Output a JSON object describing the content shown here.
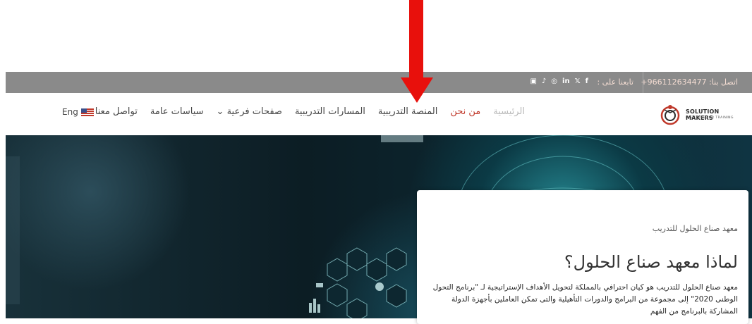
{
  "topbar": {
    "phone": "اتصل بنا: 966112634477+",
    "follow_label": "تابعنا على :",
    "social_icons": [
      "facebook-icon",
      "twitter-icon",
      "linkedin-icon",
      "instagram-icon",
      "bell-icon",
      "youtube-icon"
    ]
  },
  "logo": {
    "name": "SOLUTION MAKERS",
    "subtitle": "INSTITUTE FOR TRAINING"
  },
  "nav": {
    "items": [
      "الرئيسية",
      "من نحن",
      "المنصة التدريبية",
      "المسارات التدريبية",
      "صفحات فرعية ⌄",
      "سياسات عامة",
      "تواصل معنا"
    ],
    "lang": "Eng"
  },
  "card": {
    "label": "معهد صناع الحلول للتدريب",
    "title": "لماذا معهد صناع الحلول؟",
    "body": "معهد صناع الحلول للتدريب هو كيان احترافي بالمملكة لتحويل الأهداف الإستراتيجية لـ \"برنامج التحول الوطنى 2020\" إلى مجموعة من البرامج والدورات التأهيلية والتى تمكن العاملين بأجهزة الدولة المشاركة بالبرنامج من الفهم"
  },
  "colors": {
    "topbar": "#8a8a8a",
    "arrow": "#e8100c",
    "active": "#c0392b"
  }
}
